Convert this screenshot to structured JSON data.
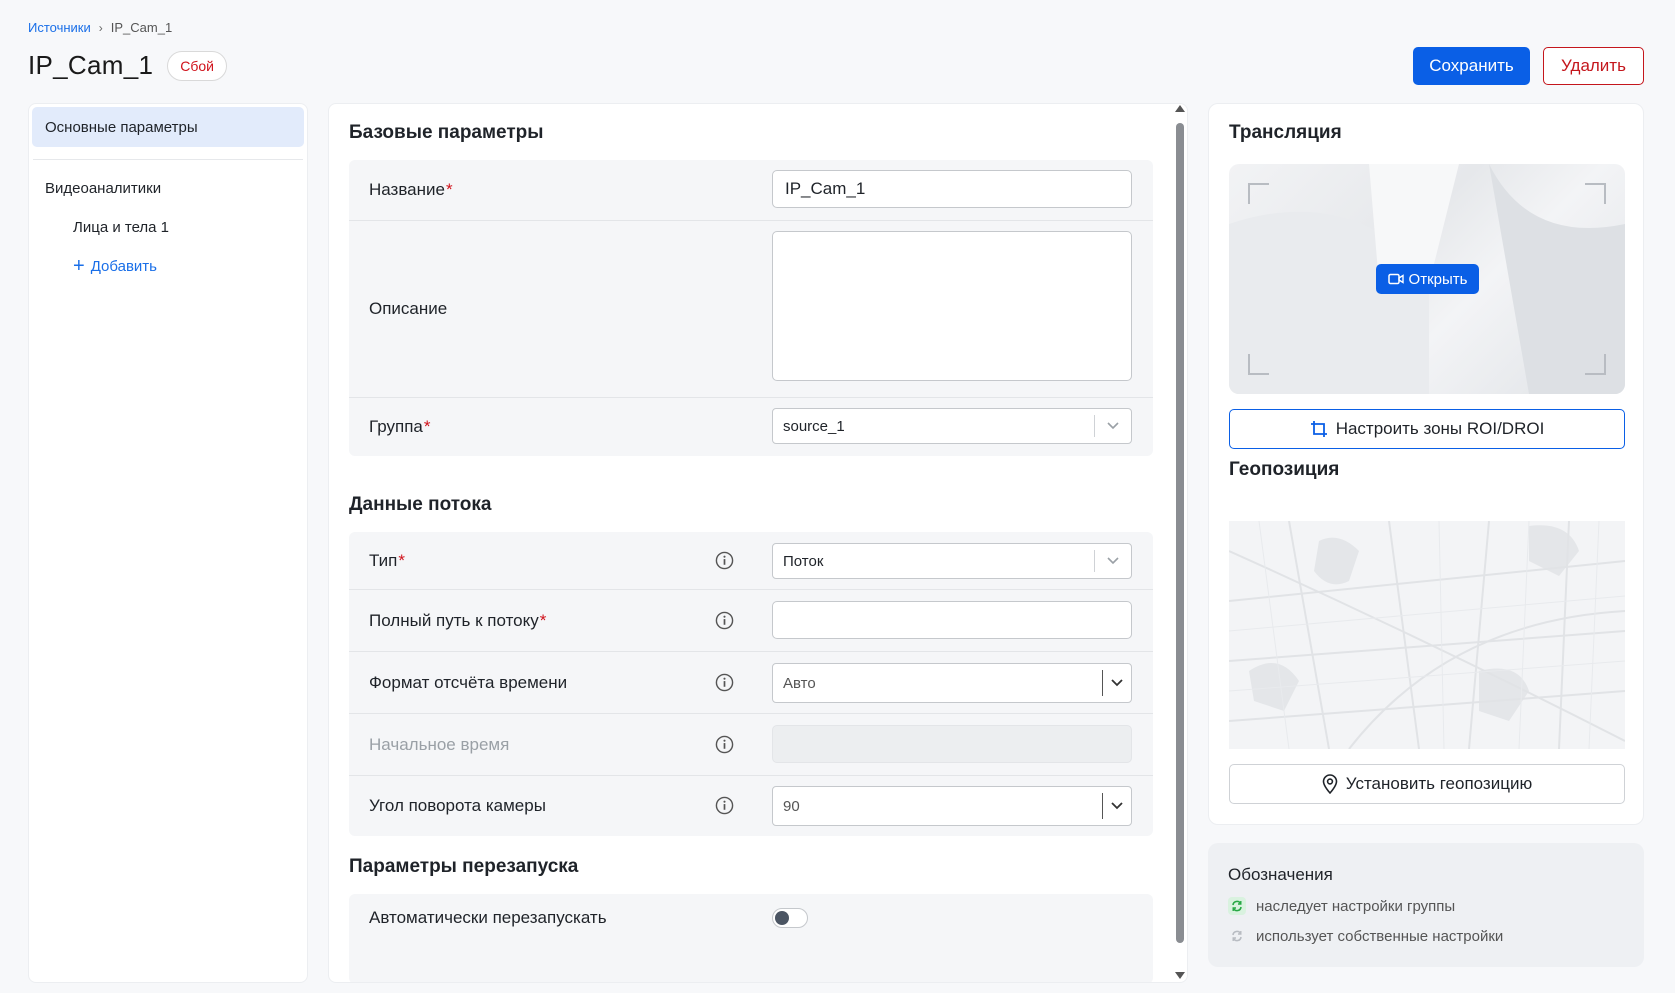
{
  "breadcrumb": {
    "root": "Источники",
    "current": "IP_Cam_1"
  },
  "header": {
    "title": "IP_Cam_1",
    "status": "Сбой",
    "save_label": "Сохранить",
    "delete_label": "Удалить"
  },
  "sidebar": {
    "active_item": "Основные параметры",
    "group": "Видеоаналитики",
    "sub_item": "Лица и тела 1",
    "add_label": "Добавить"
  },
  "base": {
    "title": "Базовые параметры",
    "name_label": "Название",
    "name_value": "IP_Cam_1",
    "desc_label": "Описание",
    "group_label": "Группа",
    "group_value": "source_1"
  },
  "stream": {
    "title": "Данные потока",
    "type_label": "Тип",
    "type_value": "Поток",
    "path_label": "Полный путь к потоку",
    "time_format_label": "Формат отсчёта времени",
    "time_format_value": "Авто",
    "start_time_label": "Начальное время",
    "rotation_label": "Угол поворота камеры",
    "rotation_value": "90"
  },
  "restart": {
    "title": "Параметры перезапуска",
    "auto_label": "Автоматически перезапускать"
  },
  "broadcast": {
    "title": "Трансляция",
    "open_label": "Открыть",
    "roi_label": "Настроить зоны ROI/DROI"
  },
  "geo": {
    "title": "Геопозиция",
    "set_label": "Установить геопозицию"
  },
  "legend": {
    "title": "Обозначения",
    "inherits": "наследует настройки группы",
    "own": "использует собственные настройки"
  },
  "colors": {
    "accent": "#0a5fe6",
    "danger": "#c4161c",
    "inherit_green": "#27a844"
  }
}
